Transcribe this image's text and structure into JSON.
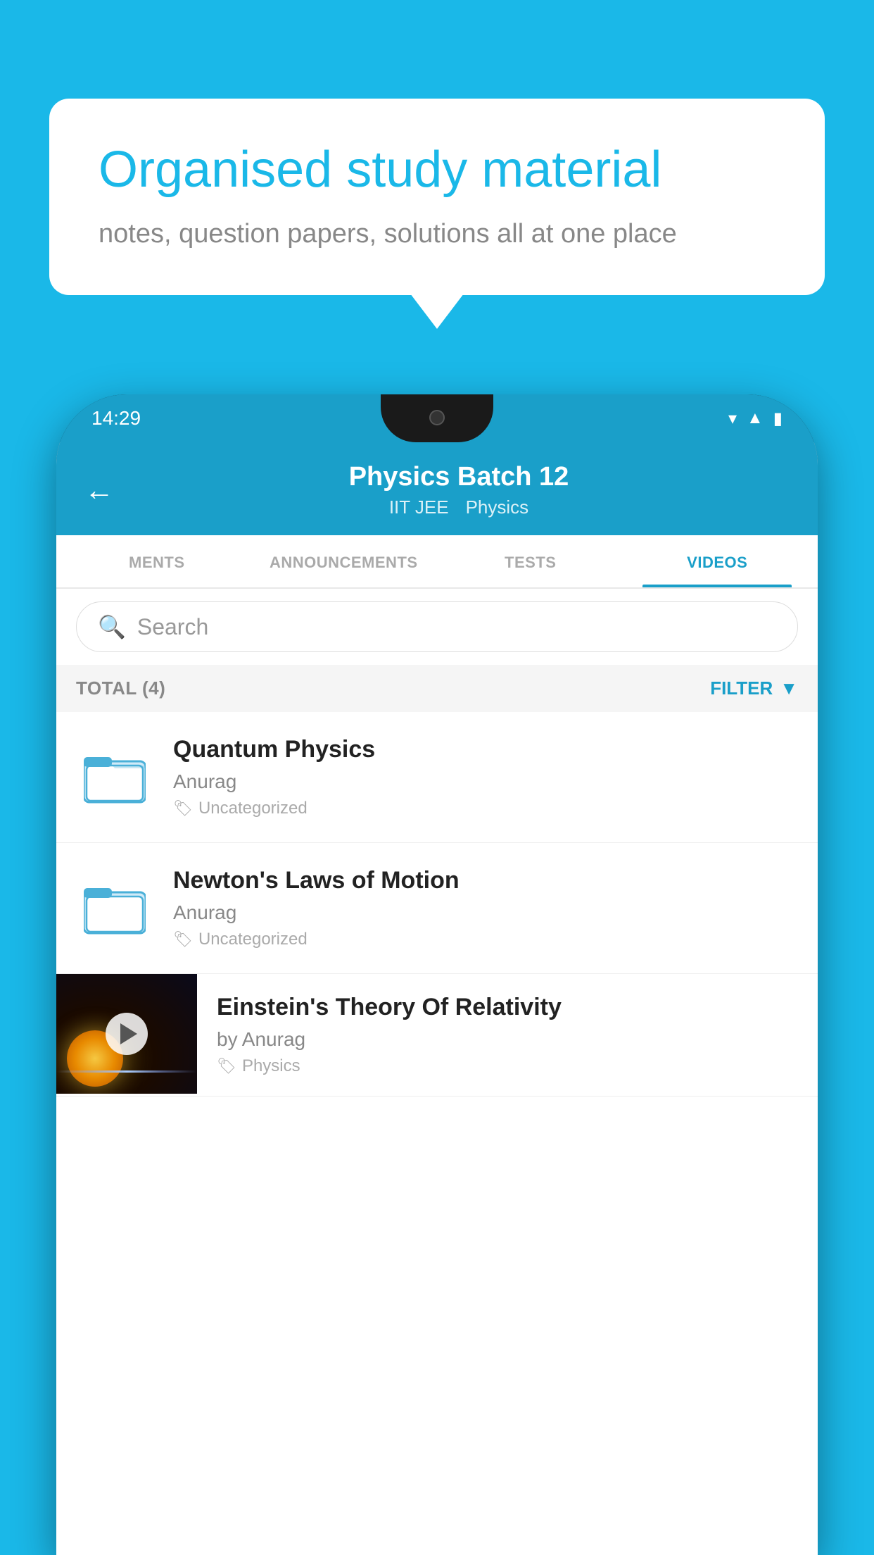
{
  "background_color": "#1ab8e8",
  "bubble": {
    "title": "Organised study material",
    "subtitle": "notes, question papers, solutions all at one place"
  },
  "phone": {
    "status_bar": {
      "time": "14:29",
      "icons": [
        "wifi",
        "signal",
        "battery"
      ]
    },
    "header": {
      "back_label": "←",
      "title": "Physics Batch 12",
      "tag1": "IIT JEE",
      "tag2": "Physics"
    },
    "tabs": [
      {
        "label": "MENTS",
        "active": false
      },
      {
        "label": "ANNOUNCEMENTS",
        "active": false
      },
      {
        "label": "TESTS",
        "active": false
      },
      {
        "label": "VIDEOS",
        "active": true
      }
    ],
    "search": {
      "placeholder": "Search"
    },
    "filter_bar": {
      "total_label": "TOTAL (4)",
      "filter_label": "FILTER"
    },
    "videos": [
      {
        "id": "quantum",
        "title": "Quantum Physics",
        "author": "Anurag",
        "tag": "Uncategorized",
        "has_thumbnail": false
      },
      {
        "id": "newton",
        "title": "Newton's Laws of Motion",
        "author": "Anurag",
        "tag": "Uncategorized",
        "has_thumbnail": false
      },
      {
        "id": "einstein",
        "title": "Einstein's Theory Of Relativity",
        "author": "by Anurag",
        "tag": "Physics",
        "has_thumbnail": true
      }
    ]
  }
}
